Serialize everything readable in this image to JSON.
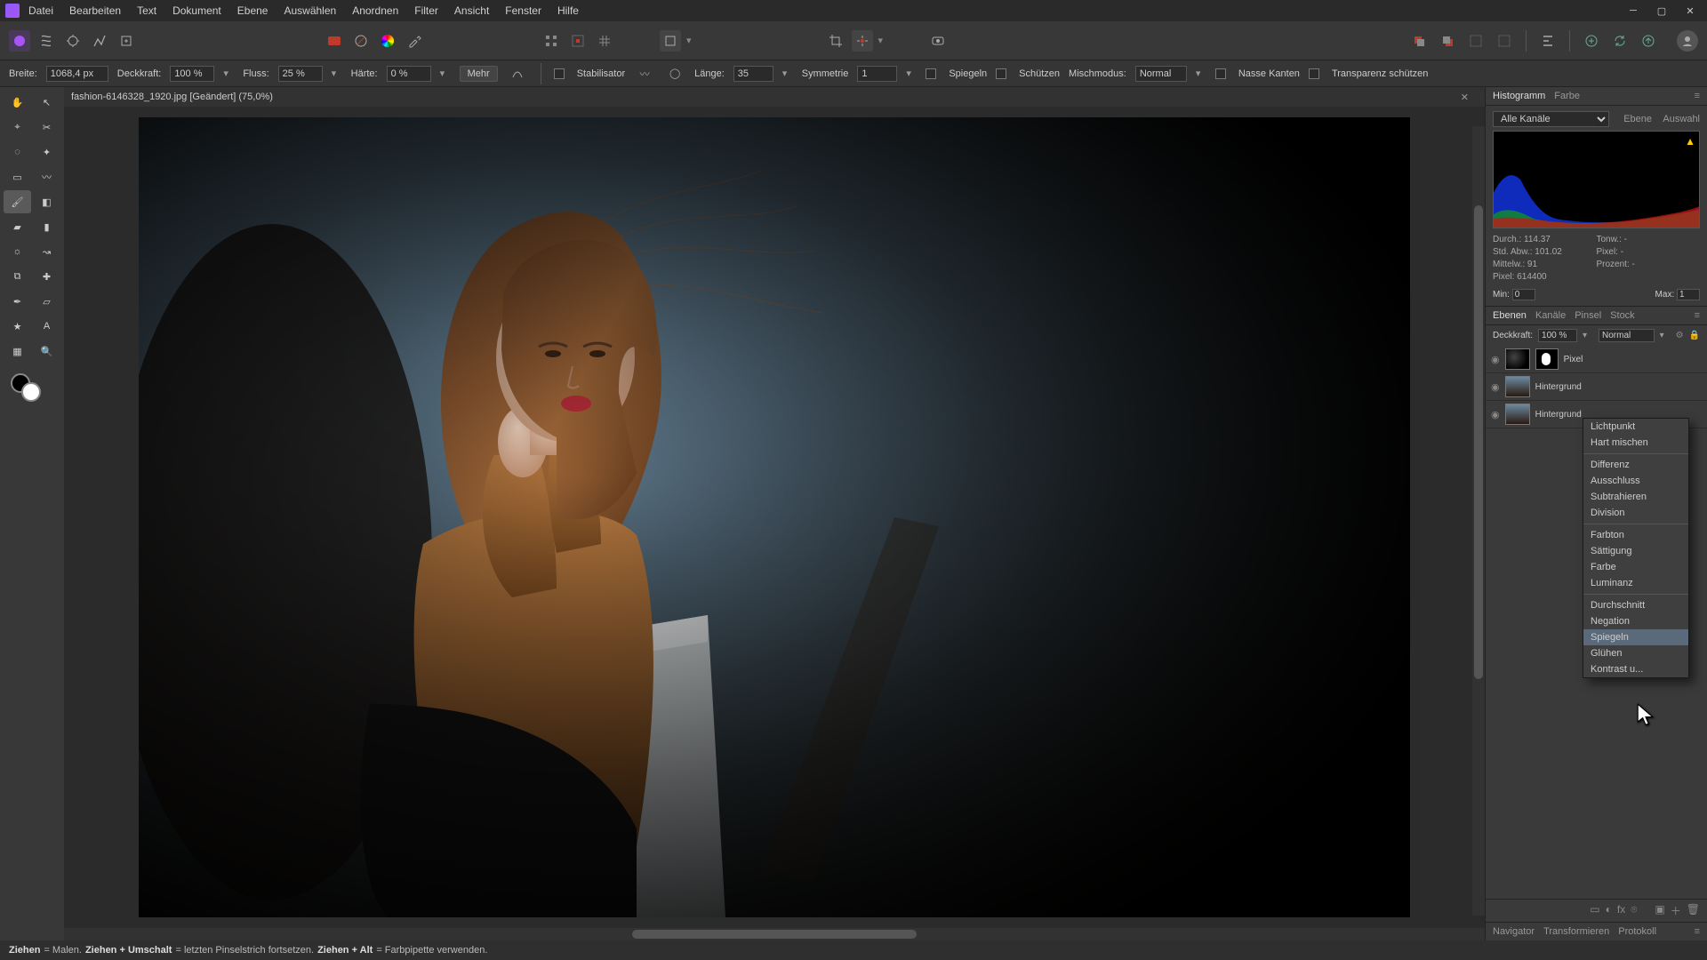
{
  "menu": {
    "items": [
      "Datei",
      "Bearbeiten",
      "Text",
      "Dokument",
      "Ebene",
      "Auswählen",
      "Anordnen",
      "Filter",
      "Ansicht",
      "Fenster",
      "Hilfe"
    ]
  },
  "context": {
    "width_label": "Breite:",
    "width_value": "1068,4 px",
    "opacity_label": "Deckkraft:",
    "opacity_value": "100 %",
    "flow_label": "Fluss:",
    "flow_value": "25 %",
    "hardness_label": "Härte:",
    "hardness_value": "0 %",
    "more_label": "Mehr",
    "stabilizer_label": "Stabilisator",
    "length_label": "Länge:",
    "length_value": "35",
    "symmetry_label": "Symmetrie",
    "symmetry_value": "1",
    "mirror_label": "Spiegeln",
    "protect_label": "Schützen",
    "blendmode_label": "Mischmodus:",
    "blendmode_value": "Normal",
    "wet_label": "Nasse Kanten",
    "protect_alpha_label": "Transparenz schützen"
  },
  "document": {
    "tab_title": "fashion-6146328_1920.jpg [Geändert] (75,0%)"
  },
  "histogram_panel": {
    "tabs": [
      "Histogramm",
      "Farbe"
    ],
    "channel_label": "Alle Kanäle",
    "scope_layer": "Ebene",
    "scope_selection": "Auswahl",
    "stats": {
      "durch_label": "Durch.:",
      "durch_value": "114.37",
      "std_label": "Std. Abw.:",
      "std_value": "101.02",
      "mittel_label": "Mittelw.:",
      "mittel_value": "91",
      "pixel_label": "Pixel:",
      "pixel_value": "614400",
      "tonw_label": "Tonw.:",
      "tonw_value": "-",
      "pixel2_label": "Pixel:",
      "pixel2_value": "-",
      "prozent_label": "Prozent:",
      "prozent_value": "-"
    },
    "min_label": "Min:",
    "min_value": "0",
    "max_label": "Max:",
    "max_value": "1"
  },
  "layers_panel": {
    "tabs": [
      "Ebenen",
      "Kanäle",
      "Pinsel",
      "Stock"
    ],
    "opacity_label": "Deckkraft:",
    "opacity_value": "100 %",
    "blend_value": "Normal",
    "layers": [
      {
        "name": "Pixel",
        "has_mask": true
      },
      {
        "name": "Hintergrund",
        "has_mask": false
      },
      {
        "name": "Hintergrund",
        "has_mask": false
      }
    ],
    "bottom_tabs": [
      "Navigator",
      "Transformieren",
      "Protokoll"
    ]
  },
  "blend_modes": {
    "items": [
      "Lichtpunkt",
      "Hart mischen",
      "",
      "Differenz",
      "Ausschluss",
      "Subtrahieren",
      "Division",
      "",
      "Farbton",
      "Sättigung",
      "Farbe",
      "Luminanz",
      "",
      "Durchschnitt",
      "Negation",
      "Spiegeln",
      "Glühen",
      "Kontrast u..."
    ],
    "highlighted": "Spiegeln"
  },
  "status": {
    "drag": "Ziehen",
    "drag_text": " = Malen. ",
    "drag_shift": "Ziehen + Umschalt",
    "drag_shift_text": " = letzten Pinselstrich fortsetzen. ",
    "drag_alt": "Ziehen + Alt",
    "drag_alt_text": " = Farbpipette verwenden."
  }
}
